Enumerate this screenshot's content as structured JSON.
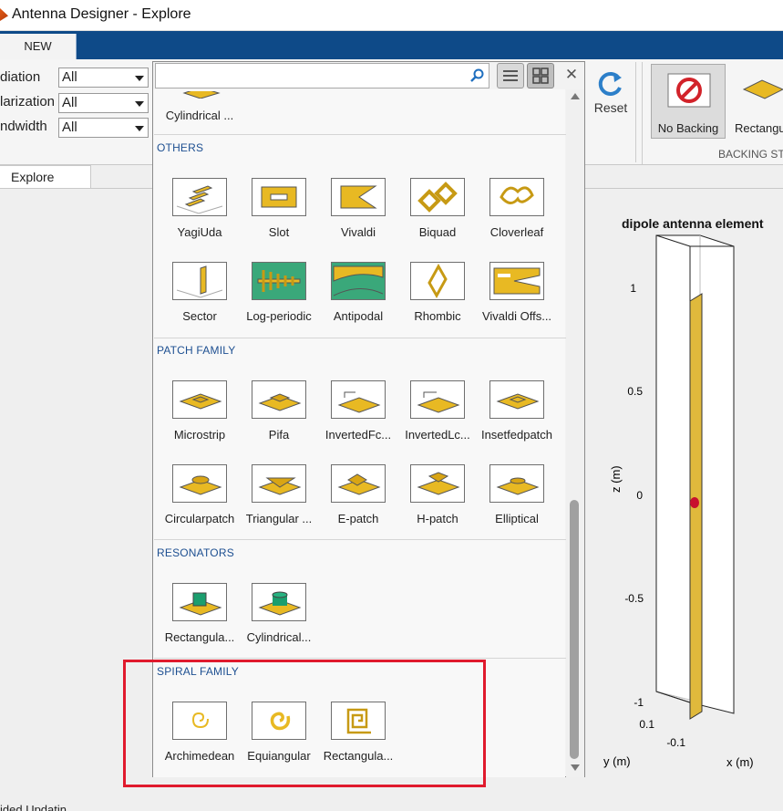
{
  "window": {
    "title": "Antenna Designer - Explore"
  },
  "ribbon": {
    "tab_new": "NEW",
    "filters": [
      {
        "label": "diation",
        "value": "All"
      },
      {
        "label": "larization",
        "value": "All"
      },
      {
        "label": "ndwidth",
        "value": "All"
      }
    ],
    "reset_label": "Reset",
    "backing": {
      "no_backing": "No Backing",
      "rectangular": "Rectangu",
      "group_title": "BACKING ST"
    }
  },
  "explore_tab": "Explore",
  "gallery": {
    "search_placeholder": "",
    "partial_item": "Cylindrical ...",
    "sections": [
      {
        "title": "OTHERS",
        "items": [
          "YagiUda",
          "Slot",
          "Vivaldi",
          "Biquad",
          "Cloverleaf",
          "Sector",
          "Log-periodic",
          "Antipodal",
          "Rhombic",
          "Vivaldi Offs..."
        ]
      },
      {
        "title": "PATCH FAMILY",
        "items": [
          "Microstrip",
          "Pifa",
          "InvertedFc...",
          "InvertedLc...",
          "Insetfedpatch",
          "Circularpatch",
          "Triangular ...",
          "E-patch",
          "H-patch",
          "Elliptical"
        ]
      },
      {
        "title": "RESONATORS",
        "items": [
          "Rectangula...",
          "Cylindrical..."
        ]
      },
      {
        "title": "SPIRAL FAMILY",
        "items": [
          "Archimedean",
          "Equiangular",
          "Rectangula..."
        ]
      }
    ]
  },
  "plot": {
    "title": "dipole antenna element",
    "z_ticks": [
      "1",
      "0.5",
      "0",
      "-0.5",
      "-1"
    ],
    "z_label": "z (m)",
    "y_ticks": [
      "0.1",
      "-0.1"
    ],
    "y_label": "y (m)",
    "x_label": "x (m)",
    "colors": {
      "element": "#e0b93c",
      "feed": "#c8102e"
    }
  },
  "status_text": "ided Updatin"
}
